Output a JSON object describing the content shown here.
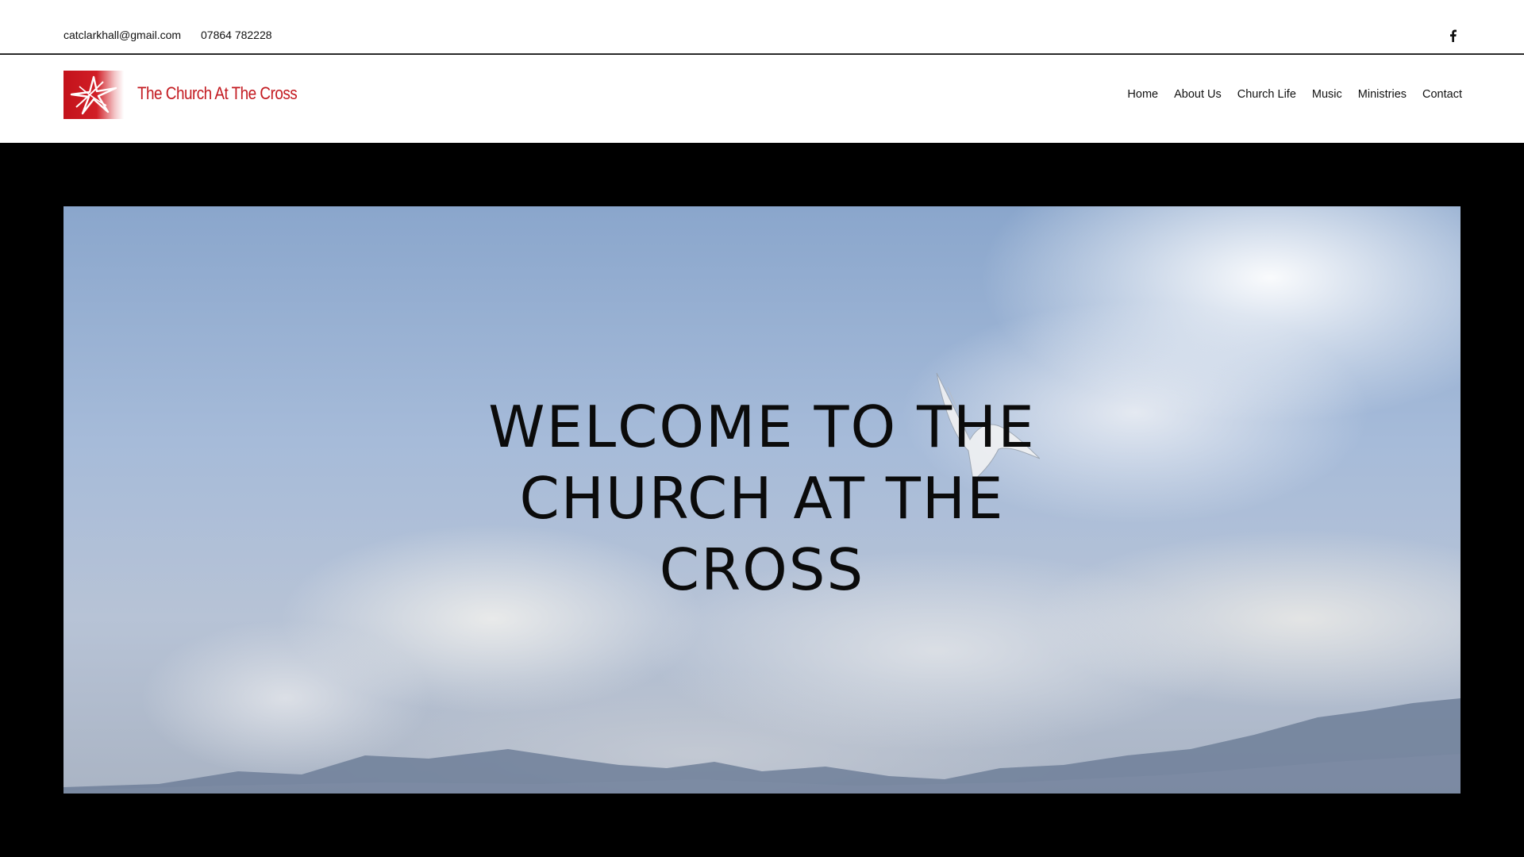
{
  "topbar": {
    "email": "catclarkhall@gmail.com",
    "phone": "07864 782228",
    "social_icon": "facebook-icon"
  },
  "header": {
    "logo_icon": "church-cross-logo",
    "site_name": "The Church At The Cross",
    "brand_color": "#c31a20"
  },
  "nav": {
    "items": [
      {
        "label": "Home"
      },
      {
        "label": "About Us"
      },
      {
        "label": "Church Life"
      },
      {
        "label": "Music"
      },
      {
        "label": "Ministries"
      },
      {
        "label": "Contact"
      }
    ]
  },
  "hero": {
    "title_lines": [
      "WELCOME TO THE",
      "CHURCH AT THE",
      "CROSS"
    ],
    "background": "sky-with-clouds-and-dove"
  }
}
